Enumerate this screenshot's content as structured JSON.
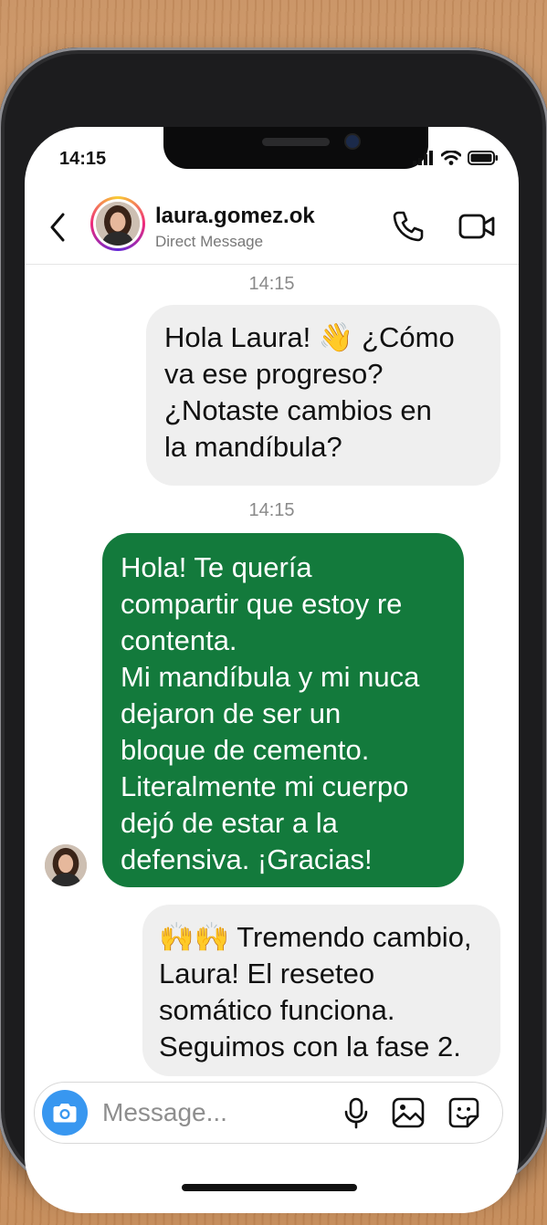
{
  "status_bar": {
    "time": "14:15"
  },
  "header": {
    "username": "laura.gomez.ok",
    "subtitle": "Direct Message"
  },
  "messages": [
    {
      "timestamp": "14:15",
      "direction": "outgoing",
      "text": "Hola Laura! 👋 ¿Cómo\nva ese progreso?\n¿Notaste cambios en\nla mandíbula?"
    },
    {
      "timestamp": "14:15",
      "direction": "incoming",
      "text": "Hola! Te quería\ncompartir que estoy re\ncontenta.\nMi mandíbula y mi nuca\ndejaron de ser un\nbloque de cemento.\nLiteralmente mi cuerpo\ndejó de estar a la\ndefensiva. ¡Gracias!"
    },
    {
      "direction": "outgoing",
      "text": "🙌🙌 Tremendo cambio,\nLaura! El reseteo\nsomático funciona.\nSeguimos con la fase 2."
    }
  ],
  "composer": {
    "placeholder": "Message..."
  },
  "icons": {
    "back": "chevron-left-icon",
    "call": "phone-icon",
    "video": "video-camera-icon",
    "camera": "camera-icon",
    "mic": "microphone-icon",
    "gallery": "image-icon",
    "sticker": "sticker-icon"
  },
  "colors": {
    "incoming_bubble": "#137a3c",
    "outgoing_bubble": "#efefef",
    "camera_button": "#3897f0"
  }
}
